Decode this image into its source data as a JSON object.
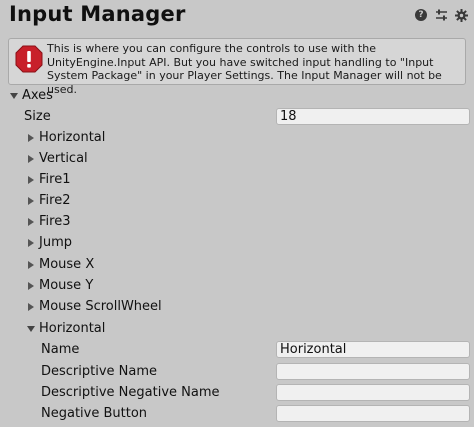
{
  "header": {
    "title": "Input Manager",
    "icons": [
      "help-icon",
      "preset-sliders-icon",
      "settings-gear-icon"
    ]
  },
  "warning": {
    "icon": "error-icon",
    "text": "This is where you can configure the controls to use with the UnityEngine.Input API. But you have switched input handling to \"Input System Package\" in your Player Settings. The Input Manager will not be used."
  },
  "axes": {
    "label": "Axes",
    "size_label": "Size",
    "size_value": "18",
    "items": [
      "Horizontal",
      "Vertical",
      "Fire1",
      "Fire2",
      "Fire3",
      "Jump",
      "Mouse X",
      "Mouse Y",
      "Mouse ScrollWheel"
    ],
    "expanded": {
      "label": "Horizontal",
      "fields": [
        {
          "label": "Name",
          "value": "Horizontal"
        },
        {
          "label": "Descriptive Name",
          "value": ""
        },
        {
          "label": "Descriptive Negative Name",
          "value": ""
        },
        {
          "label": "Negative Button",
          "value": ""
        }
      ]
    }
  }
}
